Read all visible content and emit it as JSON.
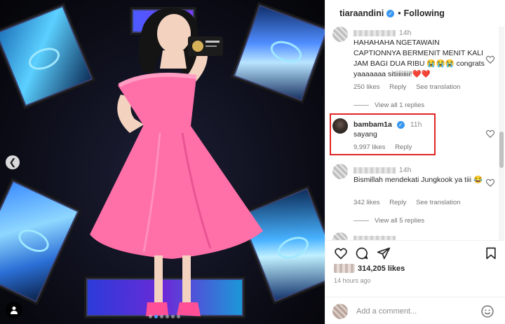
{
  "post": {
    "username": "tiaraandini",
    "follow_status": "Following",
    "separator": "•"
  },
  "comments": [
    {
      "time": "14h",
      "text": "HAHAHAHA NGETAWAIN CAPTIONNYA BERMENIT MENIT KALI JAM BAGI DUA RIBU 😭😭😭 congrats yaaaaaaa sitiiiiiiiii!❤️❤️",
      "likes": "250 likes",
      "reply": "Reply",
      "translate": "See translation",
      "view_replies": "View all 1 replies"
    },
    {
      "username": "bambam1a",
      "time": "11h",
      "text": "sayang",
      "likes": "9,997 likes",
      "reply": "Reply"
    },
    {
      "time": "14h",
      "text": "Bismillah mendekati Jungkook ya tiii 😂",
      "likes": "342 likes",
      "reply": "Reply",
      "translate": "See translation",
      "view_replies": "View all 5 replies"
    }
  ],
  "footer": {
    "likes": "314,205 likes",
    "time_ago": "14 hours ago",
    "comment_placeholder": "Add a comment..."
  },
  "icons": {
    "heart": "heart-icon",
    "comment": "comment-icon",
    "share": "share-icon",
    "save": "bookmark-icon",
    "emoji": "emoji-icon",
    "prev": "chevron-left-icon",
    "tag": "user-tag-icon"
  },
  "colors": {
    "highlight": "#e02424",
    "verified": "#3897f0",
    "dress": "#ff6fa8"
  },
  "carousel": {
    "total": 6,
    "active": 2
  }
}
